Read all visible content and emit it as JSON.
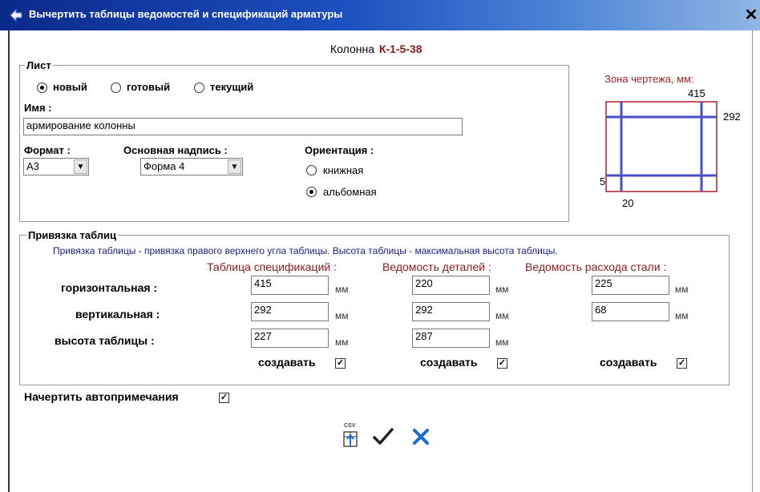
{
  "window": {
    "title": "Вычертить таблицы ведомостей и спецификаций арматуры"
  },
  "header": {
    "label": "Колонна",
    "mark": "К-1-5-38"
  },
  "sheet": {
    "legend": "Лист",
    "radios": [
      {
        "label": "новый",
        "selected": true
      },
      {
        "label": "готовый",
        "selected": false
      },
      {
        "label": "текущий",
        "selected": false
      }
    ],
    "name_label": "Имя :",
    "name_value": "армирование колонны",
    "format_label": "Формат :",
    "format_value": "A3",
    "stamp_label": "Основная надпись :",
    "stamp_value": "Форма 4",
    "orientation_label": "Ориентация :",
    "orientation": [
      {
        "label": "книжная",
        "selected": false
      },
      {
        "label": "альбомная",
        "selected": true
      }
    ]
  },
  "zone": {
    "title": "Зона чертежа, мм:",
    "top": "415",
    "right": "292",
    "left": "5",
    "bottom": "20"
  },
  "binding": {
    "legend": "Привязка таблиц",
    "note": "Привязка таблицы - привязка правого верхнего угла таблицы. Высота таблицы - максимальная высота таблицы.",
    "columns": [
      "Таблица спецификаций :",
      "Ведомость деталей :",
      "Ведомость расхода стали :"
    ],
    "rows": [
      {
        "label": "горизонтальная :",
        "values": [
          "415",
          "220",
          "225"
        ]
      },
      {
        "label": "вертикальная :",
        "values": [
          "292",
          "292",
          "68"
        ]
      },
      {
        "label": "высота таблицы :",
        "values": [
          "227",
          "287",
          ""
        ]
      }
    ],
    "unit": "мм",
    "create_label": "создавать"
  },
  "autonotes": {
    "label": "Начертить автопримечания"
  },
  "toolbar": {
    "csv_label": "CSV"
  },
  "colors": {
    "accent_red": "#8b1a1a",
    "blue_text": "#1a1a8c",
    "zone_border": "#b01e2e",
    "zone_lines": "#4c4ec8"
  }
}
